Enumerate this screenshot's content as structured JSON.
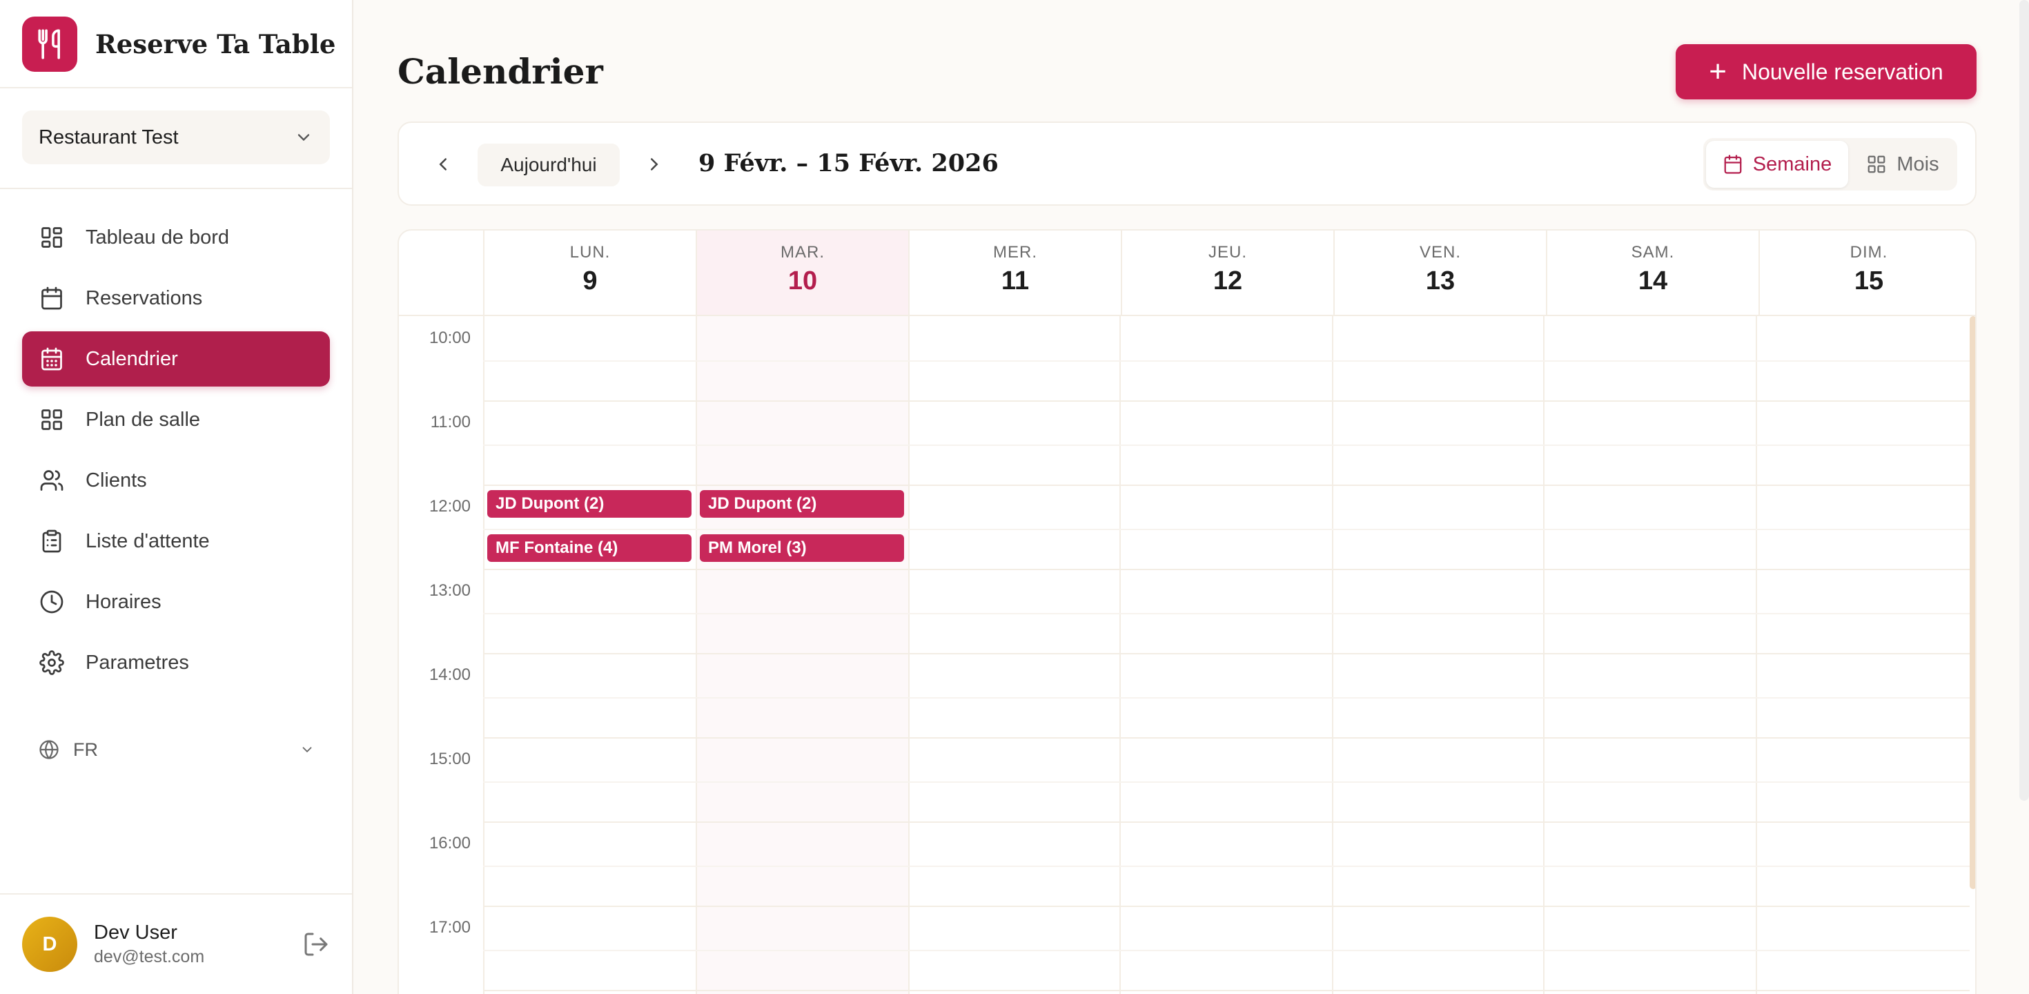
{
  "app": {
    "name": "Reserve Ta Table"
  },
  "restaurant_select": {
    "value": "Restaurant Test"
  },
  "nav": [
    {
      "label": "Tableau de bord",
      "icon": "dashboard-icon"
    },
    {
      "label": "Reservations",
      "icon": "calendar-icon"
    },
    {
      "label": "Calendrier",
      "icon": "calendar-days-icon",
      "active": true
    },
    {
      "label": "Plan de salle",
      "icon": "grid-icon"
    },
    {
      "label": "Clients",
      "icon": "users-icon"
    },
    {
      "label": "Liste d'attente",
      "icon": "clipboard-icon"
    },
    {
      "label": "Horaires",
      "icon": "clock-icon"
    },
    {
      "label": "Parametres",
      "icon": "gear-icon"
    }
  ],
  "language": {
    "value": "FR"
  },
  "user": {
    "initial": "D",
    "name": "Dev User",
    "email": "dev@test.com"
  },
  "page": {
    "title": "Calendrier",
    "new_button": "Nouvelle reservation"
  },
  "toolbar": {
    "today": "Aujourd'hui",
    "range": "9 Févr. – 15 Févr. 2026",
    "view_week": "Semaine",
    "view_month": "Mois",
    "active_view": "week"
  },
  "days": [
    {
      "name": "LUN.",
      "num": "9"
    },
    {
      "name": "MAR.",
      "num": "10",
      "today": true
    },
    {
      "name": "MER.",
      "num": "11"
    },
    {
      "name": "JEU.",
      "num": "12"
    },
    {
      "name": "VEN.",
      "num": "13"
    },
    {
      "name": "SAM.",
      "num": "14"
    },
    {
      "name": "DIM.",
      "num": "15"
    }
  ],
  "hours": [
    "10:00",
    "11:00",
    "12:00",
    "13:00",
    "14:00",
    "15:00",
    "16:00",
    "17:00"
  ],
  "events": [
    {
      "day": 0,
      "start": "12:00",
      "label": "JD Dupont (2)"
    },
    {
      "day": 0,
      "start": "12:30",
      "label": "MF Fontaine (4)"
    },
    {
      "day": 1,
      "start": "12:00",
      "label": "JD Dupont (2)"
    },
    {
      "day": 1,
      "start": "12:30",
      "label": "PM Morel (3)"
    }
  ],
  "colors": {
    "accent": "#c81e51",
    "active_nav": "#b01f4c",
    "event": "#c8285a",
    "today_bg": "#fcf0f3"
  }
}
